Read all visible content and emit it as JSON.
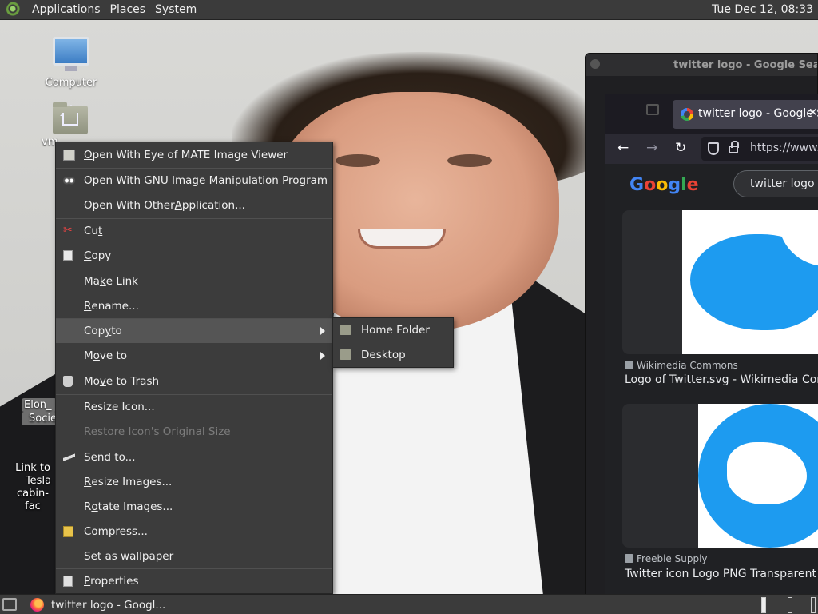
{
  "top_panel": {
    "menus": [
      "Applications",
      "Places",
      "System"
    ],
    "clock": "Tue Dec 12, 08:33"
  },
  "desktop": {
    "icons": [
      {
        "label": "Computer"
      },
      {
        "label": "vm"
      },
      {
        "label_line1": "Elon_",
        "label_line2": "Socie"
      },
      {
        "label_line1": "Link to",
        "label_line2": "Tesla",
        "label_line3": "cabin-fac"
      }
    ]
  },
  "firefox": {
    "back_window_title": "twitter logo - Google Search –",
    "tab_title": "twitter logo - Google S",
    "url": "https://www.",
    "google_logo": [
      "G",
      "o",
      "o",
      "g",
      "l",
      "e"
    ],
    "search_query": "twitter logo",
    "results": [
      {
        "source": "Wikimedia Commons",
        "title": "Logo of Twitter.svg - Wikimedia Comm"
      },
      {
        "source": "Freebie Supply",
        "title": "Twitter icon Logo PNG Transparent & S"
      }
    ]
  },
  "context_menu": {
    "items": [
      {
        "pre": "",
        "u": "O",
        "post": "pen With Eye of MATE Image Viewer",
        "icon": "image-viewer-icon"
      },
      {
        "pre": "Open With GNU Image Manipulation Program",
        "u": "",
        "post": "",
        "icon": "gimp-icon"
      },
      {
        "pre": "Open With Other ",
        "u": "A",
        "post": "pplication...",
        "icon": ""
      },
      {
        "pre": "Cu",
        "u": "t",
        "post": "",
        "icon": "scissors-icon"
      },
      {
        "pre": "",
        "u": "C",
        "post": "opy",
        "icon": "copy-icon"
      },
      {
        "pre": "Ma",
        "u": "k",
        "post": "e Link",
        "icon": ""
      },
      {
        "pre": "",
        "u": "R",
        "post": "ename...",
        "icon": ""
      },
      {
        "pre": "Cop",
        "u": "y",
        "post": " to",
        "icon": ""
      },
      {
        "pre": "M",
        "u": "o",
        "post": "ve to",
        "icon": ""
      },
      {
        "pre": "Mo",
        "u": "v",
        "post": "e to Trash",
        "icon": "trash-icon"
      },
      {
        "pre": "Resize Icon...",
        "u": "",
        "post": "",
        "icon": ""
      },
      {
        "pre": "Restore Icon's Original Size",
        "u": "",
        "post": "",
        "icon": ""
      },
      {
        "pre": "Send to...",
        "u": "",
        "post": "",
        "icon": "send-icon"
      },
      {
        "pre": "",
        "u": "R",
        "post": "esize Images...",
        "icon": ""
      },
      {
        "pre": "R",
        "u": "o",
        "post": "tate Images...",
        "icon": ""
      },
      {
        "pre": "Compress...",
        "u": "",
        "post": "",
        "icon": "compress-icon"
      },
      {
        "pre": "Set as wallpaper",
        "u": "",
        "post": "",
        "icon": ""
      },
      {
        "pre": "",
        "u": "P",
        "post": "roperties",
        "icon": "properties-icon"
      }
    ],
    "submenu": [
      "Home Folder",
      "Desktop"
    ]
  },
  "taskbar": {
    "task_label": "twitter logo - Googl..."
  }
}
